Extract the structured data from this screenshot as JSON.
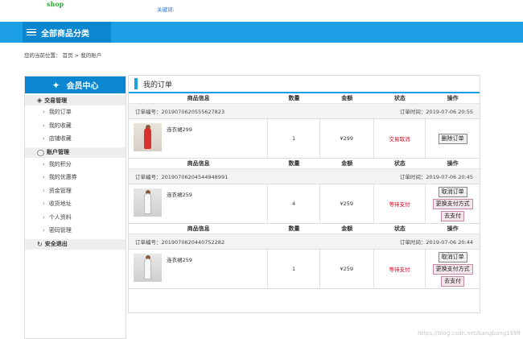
{
  "header": {
    "logo": "shop",
    "keyword_label": "关键词:"
  },
  "catbar": {
    "label": "全部商品分类"
  },
  "breadcrumb": {
    "prefix": "您的当前位置：",
    "home": "首页",
    "sep": ">",
    "current": "我的账户"
  },
  "sidebar": {
    "title": "会员中心",
    "groups": [
      {
        "label": "交易管理",
        "items": [
          "我的订单",
          "我的收藏",
          "店铺收藏"
        ]
      },
      {
        "label": "账户管理",
        "items": [
          "我的积分",
          "我的优惠券",
          "资金管理",
          "收货地址",
          "个人资料",
          "密码管理"
        ]
      }
    ],
    "logout": "安全退出"
  },
  "panel": {
    "title": "我的订单",
    "columns": [
      "商品信息",
      "数量",
      "金额",
      "状态",
      "操作"
    ],
    "orders": [
      {
        "number_label": "订单编号：2019070620555627823",
        "time_label": "订单时间：2019-07-06 20:55",
        "product": "连衣裙299",
        "qty": "1",
        "amount": "¥299",
        "status": "交易取消",
        "actions": [
          "删除订单"
        ]
      },
      {
        "number_label": "订单编号：20190706204544948991",
        "time_label": "订单时间：2019-07-06 20:45",
        "product": "连衣裙259",
        "qty": "4",
        "amount": "¥259",
        "status": "等待支付",
        "actions": [
          "取消订单",
          "更换支付方式",
          "去支付"
        ]
      },
      {
        "number_label": "订单编号：2019070620440752282",
        "time_label": "订单时间：2019-07-06 20:44",
        "product": "连衣裙259",
        "qty": "1",
        "amount": "¥259",
        "status": "等待支付",
        "actions": [
          "取消订单",
          "更换支付方式",
          "去支付"
        ]
      }
    ]
  },
  "watermark": "https://blog.csdn.net/bangbang1999",
  "colors": {
    "brand": "#1d9fe6",
    "brand_dark": "#0b86d0",
    "status": "#d0021b",
    "logo": "#2eaa3c"
  }
}
